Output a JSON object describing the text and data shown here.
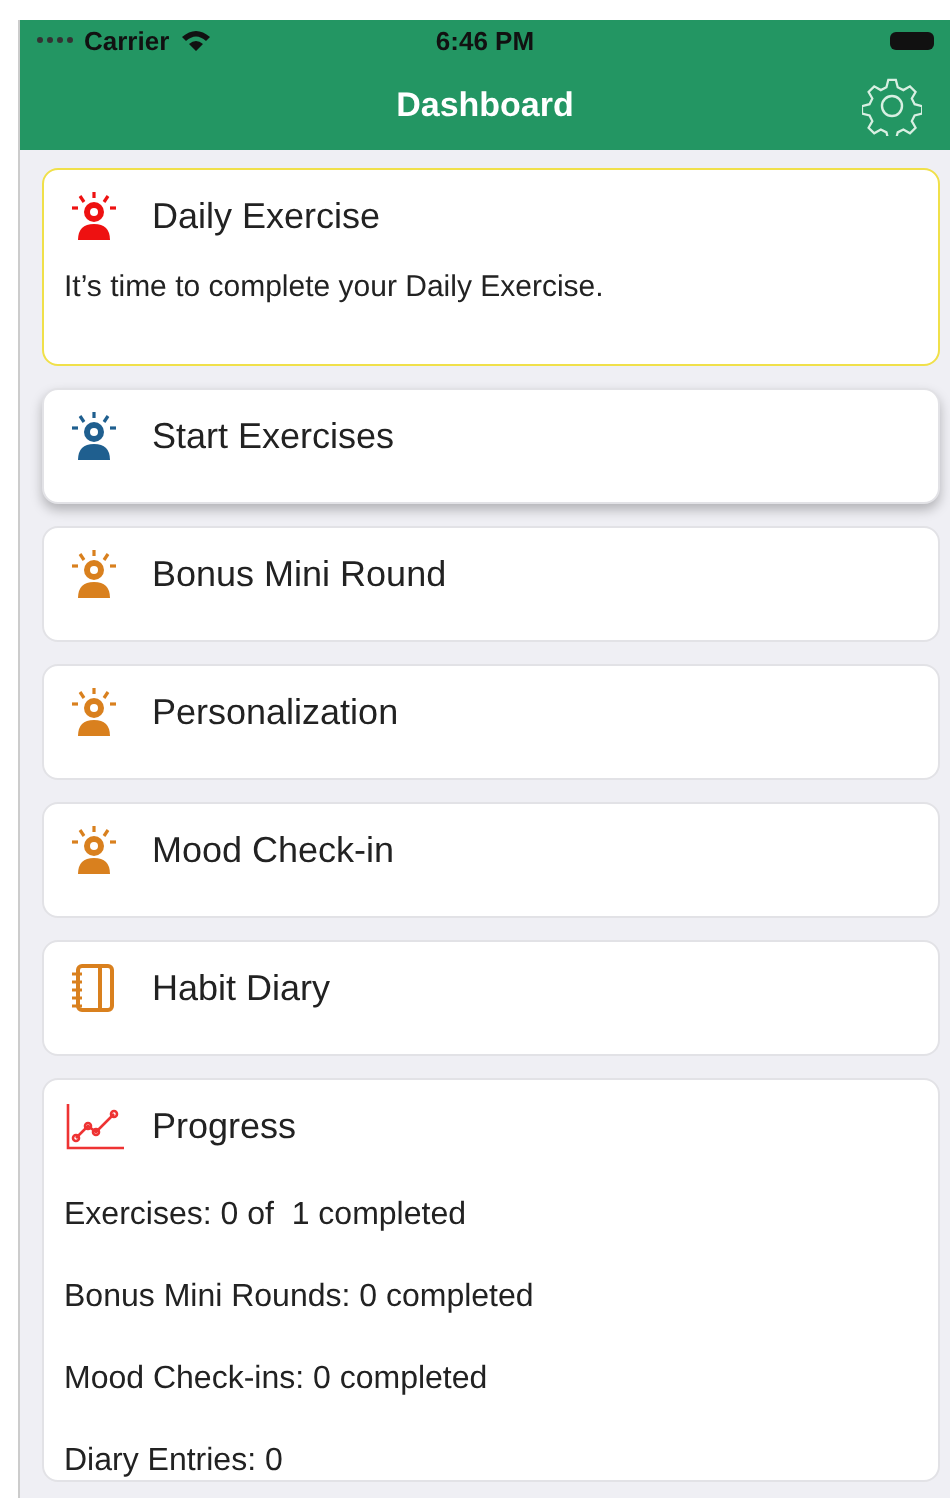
{
  "status_bar": {
    "carrier": "Carrier",
    "time": "6:46 PM"
  },
  "nav_bar": {
    "title": "Dashboard"
  },
  "cards": [
    {
      "kind": "alert",
      "color": "#ee1111",
      "title": "Daily Exercise",
      "highlighted": true,
      "raised": false,
      "body": "It’s time to complete your Daily Exercise."
    },
    {
      "kind": "alert",
      "color": "#1f5f8f",
      "title": "Start Exercises",
      "highlighted": false,
      "raised": true
    },
    {
      "kind": "alert",
      "color": "#d9801e",
      "title": "Bonus Mini Round",
      "highlighted": false,
      "raised": false
    },
    {
      "kind": "alert",
      "color": "#d9801e",
      "title": "Personalization",
      "highlighted": false,
      "raised": false
    },
    {
      "kind": "alert",
      "color": "#d9801e",
      "title": "Mood Check-in",
      "highlighted": false,
      "raised": false
    },
    {
      "kind": "journal",
      "color": "#d9801e",
      "title": "Habit Diary",
      "highlighted": false,
      "raised": false
    },
    {
      "kind": "stats",
      "color": "#ee3333",
      "title": "Progress",
      "highlighted": false,
      "raised": false,
      "lines": [
        "Exercises: 0 of  1 completed",
        "Bonus Mini Rounds: 0 completed",
        "Mood Check-ins: 0 completed",
        "Diary Entries: 0"
      ]
    }
  ]
}
